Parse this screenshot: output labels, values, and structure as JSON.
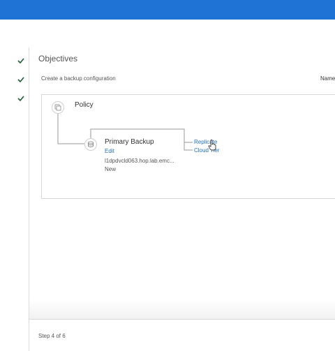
{
  "wizard": {
    "steps_completed": [
      {
        "icon": "check-icon",
        "state": "done"
      },
      {
        "icon": "check-icon",
        "state": "done"
      },
      {
        "icon": "check-icon",
        "state": "done"
      }
    ],
    "step_indicator": "Step 4 of 6"
  },
  "objectives": {
    "title": "Objectives",
    "subtitle": "Create a backup configuration",
    "name_header": "Name"
  },
  "policy": {
    "label": "Policy",
    "icon": "copy-icon"
  },
  "primary_backup": {
    "label": "Primary Backup",
    "edit_label": "Edit",
    "host": "l1dpdvcld063.hop.lab.emc...",
    "status": "New",
    "icon": "database-icon"
  },
  "actions": {
    "replicate": "Replicate",
    "cloud_tier": "Cloud Tier"
  },
  "colors": {
    "header": "#1f73d4",
    "link": "#1f6fc2",
    "check": "#1e5a36"
  }
}
